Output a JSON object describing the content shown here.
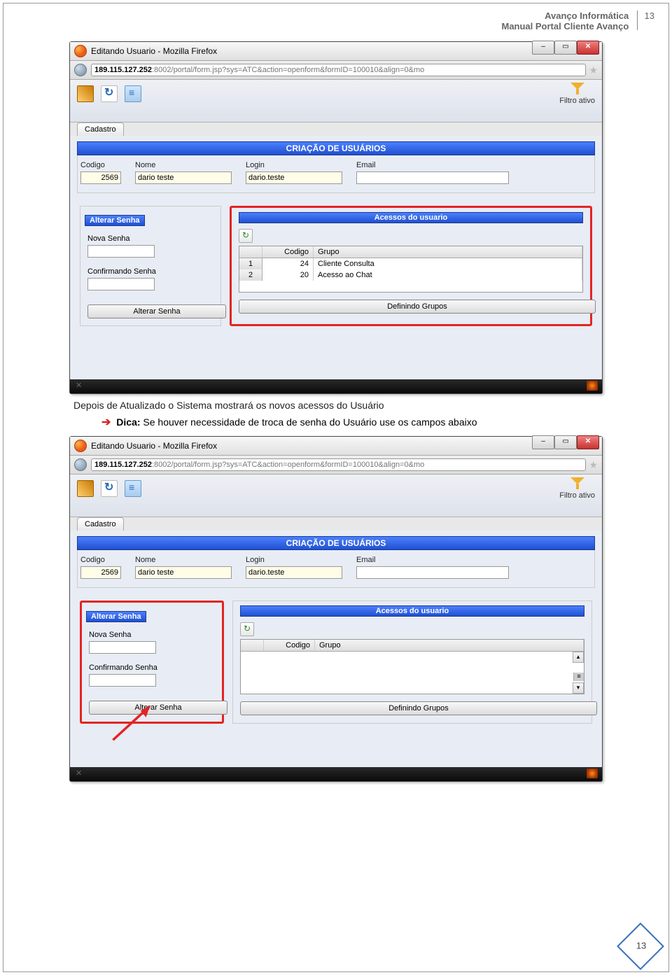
{
  "header": {
    "line1": "Avanço Informática",
    "line2": "Manual Portal Cliente Avanço",
    "page_top": "13"
  },
  "body": {
    "caption1": "Depois de Atualizado o Sistema mostrará os novos acessos do Usuário",
    "dica_label": "Dica:",
    "dica_text": " Se houver necessidade de troca de senha do Usuário use os campos abaixo"
  },
  "shot": {
    "window_title": "Editando Usuario - Mozilla Firefox",
    "url_bold": "189.115.127.252",
    "url_rest": ":8002/portal/form.jsp?sys=ATC&action=openform&formID=100010&align=0&mo",
    "filtro": "Filtro ativo",
    "tab": "Cadastro",
    "section_title": "CRIAÇÃO DE USUÁRIOS",
    "labels": {
      "codigo": "Codigo",
      "nome": "Nome",
      "login": "Login",
      "email": "Email"
    },
    "values": {
      "codigo": "2569",
      "nome": "dario teste",
      "login": "dario.teste",
      "email": ""
    },
    "alterar_senha_title": "Alterar Senha",
    "nova_senha": "Nova Senha",
    "confirmando_senha": "Confirmando Senha",
    "alterar_senha_btn": "Alterar Senha",
    "acessos_title": "Acessos do usuario",
    "grid": {
      "col_codigo": "Codigo",
      "col_grupo": "Grupo",
      "rows": [
        {
          "n": "1",
          "codigo": "24",
          "grupo": "Cliente Consulta"
        },
        {
          "n": "2",
          "codigo": "20",
          "grupo": "Acesso ao Chat"
        }
      ]
    },
    "definindo_grupos": "Definindo Grupos"
  },
  "page_bottom": "13"
}
